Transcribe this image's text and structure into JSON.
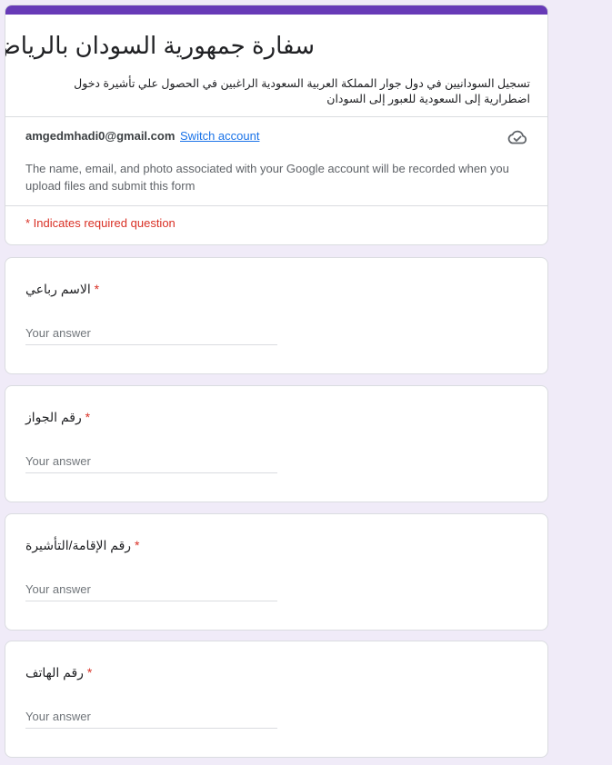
{
  "form": {
    "title": "سفارة جمهورية السودان بالرياض",
    "description": "تسجيل السودانيين في دول جوار المملكة العربية السعودية الراغبين في الحصول علي تأشيرة دخول اضطرارية إلى السعودية للعبور إلى السودان",
    "accent_color": "#673ab7",
    "background_color": "#f0ebf8"
  },
  "account": {
    "email": "amgedmhadi0@gmail.com",
    "switch_label": "Switch account",
    "icon": "cloud-check-icon",
    "notice": "The name, email, and photo associated with your Google account will be recorded when you upload files and submit this form"
  },
  "required_note": "* Indicates required question",
  "required_color": "#d93025",
  "questions": [
    {
      "label": "الاسم رباعي",
      "asterisk": "*",
      "placeholder": "Your answer"
    },
    {
      "label": "رقم الجواز",
      "asterisk": "*",
      "placeholder": "Your answer"
    },
    {
      "label": "رقم الإقامة/التأشيرة",
      "asterisk": "*",
      "placeholder": "Your answer"
    },
    {
      "label": "رقم الهاتف",
      "asterisk": "*",
      "placeholder": "Your answer"
    }
  ]
}
